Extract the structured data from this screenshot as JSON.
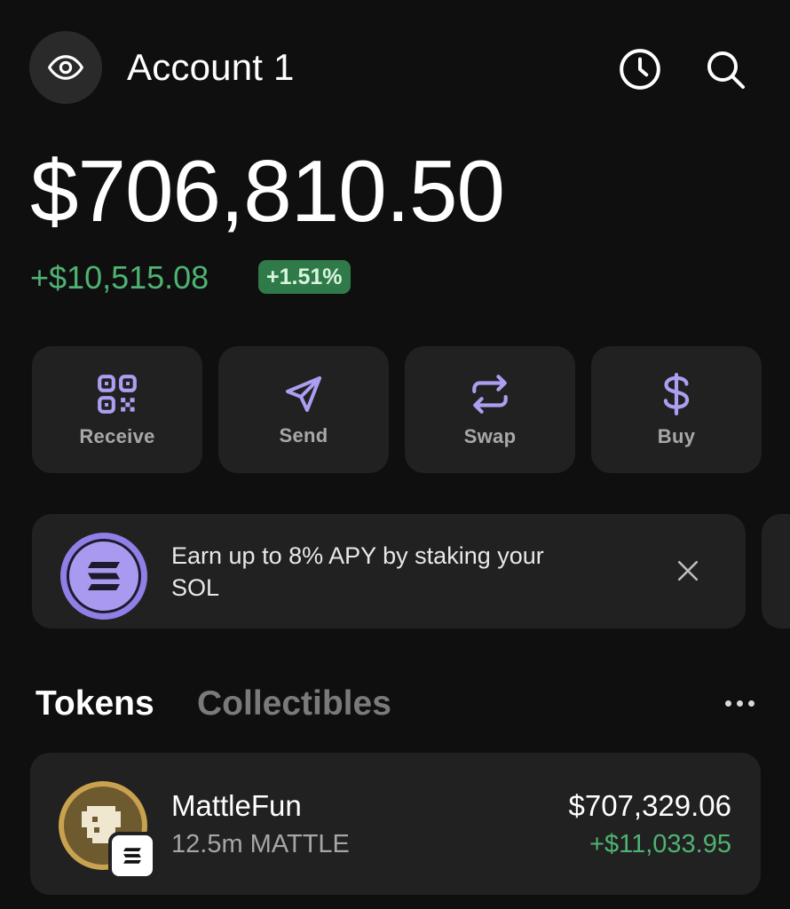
{
  "header": {
    "account_name": "Account 1",
    "eye_icon": "eye-icon",
    "history_icon": "clock-icon",
    "search_icon": "search-icon"
  },
  "balance": {
    "total": "$706,810.50",
    "change": "+$10,515.08",
    "change_pct": "+1.51%"
  },
  "actions": [
    {
      "label": "Receive",
      "icon": "qr-code-icon"
    },
    {
      "label": "Send",
      "icon": "send-icon"
    },
    {
      "label": "Swap",
      "icon": "swap-icon"
    },
    {
      "label": "Buy",
      "icon": "dollar-icon"
    }
  ],
  "promo": {
    "text": "Earn up to 8% APY by staking your SOL",
    "icon": "solana-icon"
  },
  "tabs": {
    "active": "Tokens",
    "inactive": "Collectibles"
  },
  "tokens": [
    {
      "name": "MattleFun",
      "amount": "12.5m MATTLE",
      "value": "$707,329.06",
      "change": "+$11,033.95"
    }
  ],
  "colors": {
    "background": "#0f0f0f",
    "card": "#212121",
    "accent": "#ab9ff2",
    "positive": "#4fb272"
  }
}
